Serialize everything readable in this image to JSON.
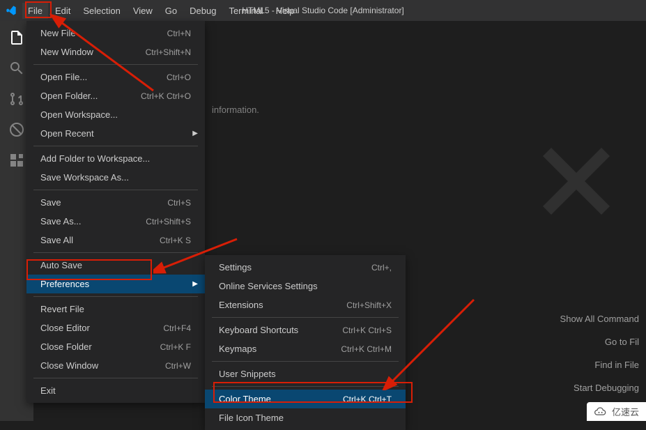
{
  "window_title": "HTML5 - Visual Studio Code [Administrator]",
  "menubar": {
    "file": "File",
    "edit": "Edit",
    "selection": "Selection",
    "view": "View",
    "go": "Go",
    "debug": "Debug",
    "terminal": "Terminal",
    "help": "Help"
  },
  "file_menu": {
    "new_file": {
      "label": "New File",
      "shortcut": "Ctrl+N"
    },
    "new_window": {
      "label": "New Window",
      "shortcut": "Ctrl+Shift+N"
    },
    "open_file": {
      "label": "Open File...",
      "shortcut": "Ctrl+O"
    },
    "open_folder": {
      "label": "Open Folder...",
      "shortcut": "Ctrl+K Ctrl+O"
    },
    "open_workspace": {
      "label": "Open Workspace...",
      "shortcut": ""
    },
    "open_recent": {
      "label": "Open Recent",
      "shortcut": ""
    },
    "add_folder": {
      "label": "Add Folder to Workspace...",
      "shortcut": ""
    },
    "save_workspace_as": {
      "label": "Save Workspace As...",
      "shortcut": ""
    },
    "save": {
      "label": "Save",
      "shortcut": "Ctrl+S"
    },
    "save_as": {
      "label": "Save As...",
      "shortcut": "Ctrl+Shift+S"
    },
    "save_all": {
      "label": "Save All",
      "shortcut": "Ctrl+K S"
    },
    "auto_save": {
      "label": "Auto Save",
      "shortcut": ""
    },
    "preferences": {
      "label": "Preferences",
      "shortcut": ""
    },
    "revert_file": {
      "label": "Revert File",
      "shortcut": ""
    },
    "close_editor": {
      "label": "Close Editor",
      "shortcut": "Ctrl+F4"
    },
    "close_folder": {
      "label": "Close Folder",
      "shortcut": "Ctrl+K F"
    },
    "close_window": {
      "label": "Close Window",
      "shortcut": "Ctrl+W"
    },
    "exit": {
      "label": "Exit",
      "shortcut": ""
    }
  },
  "pref_menu": {
    "settings": {
      "label": "Settings",
      "shortcut": "Ctrl+,"
    },
    "online_services": {
      "label": "Online Services Settings",
      "shortcut": ""
    },
    "extensions": {
      "label": "Extensions",
      "shortcut": "Ctrl+Shift+X"
    },
    "keyboard_shortcuts": {
      "label": "Keyboard Shortcuts",
      "shortcut": "Ctrl+K Ctrl+S"
    },
    "keymaps": {
      "label": "Keymaps",
      "shortcut": "Ctrl+K Ctrl+M"
    },
    "user_snippets": {
      "label": "User Snippets",
      "shortcut": ""
    },
    "color_theme": {
      "label": "Color Theme",
      "shortcut": "Ctrl+K Ctrl+T"
    },
    "file_icon_theme": {
      "label": "File Icon Theme",
      "shortcut": ""
    }
  },
  "content": {
    "info_text": "information."
  },
  "commands": {
    "show_all": "Show All Command",
    "go_to_file": "Go to Fil",
    "find_in_file": "Find in File",
    "start_debugging": "Start Debugging"
  },
  "watermark": "亿速云"
}
